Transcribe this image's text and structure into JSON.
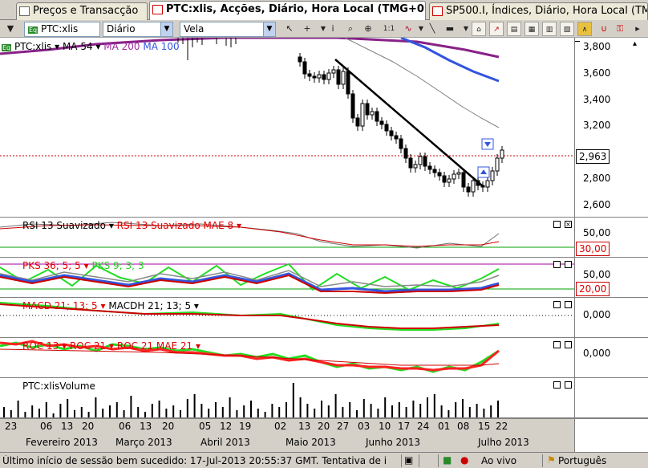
{
  "tabs": [
    {
      "label": "Preços e Transacção"
    },
    {
      "label": "PTC:xlis, Acções, Diário, Hora Local (TMG+0)"
    },
    {
      "label": "SP500.I, Índices, Diário, Hora Local (TM"
    }
  ],
  "toolbar": {
    "symbol": "PTC:xlis",
    "period": "Diário",
    "chart_style": "Vela"
  },
  "price_panel": {
    "symbol_label": "PTC:xlis",
    "indicators": [
      "MA 54",
      "MA 200",
      "MA 100"
    ],
    "last_price": "2,963",
    "y_ticks": [
      "3,800",
      "3,600",
      "3,400",
      "3,200",
      "3,000",
      "2,800",
      "2,600"
    ]
  },
  "rsi_panel": {
    "label1": "RSI 13 Suavizado",
    "label2": "RSI 13 Suavizado MAE 8",
    "ticks": [
      "50,00"
    ],
    "value": "30,00"
  },
  "pks_panel": {
    "label1": "PKS 36; 5; 5",
    "label2": "PKS 9; 3; 3",
    "ticks": [
      "50,00"
    ],
    "value": "20,00"
  },
  "macd_panel": {
    "label1": "MACD 21; 13; 5",
    "label2": "MACDH 21; 13; 5",
    "ticks": [
      "0,000"
    ]
  },
  "roc_panel": {
    "label1": "ROC 13",
    "label2": "ROC 21",
    "label3": "ROC 21 MAE 21",
    "ticks": [
      "0,000"
    ]
  },
  "volume_panel": {
    "label": "PTC:xlisVolume"
  },
  "date_axis": {
    "days": [
      "23",
      "06",
      "13",
      "20",
      "06",
      "13",
      "20",
      "05",
      "12",
      "19",
      "02",
      "13",
      "20",
      "27",
      "03",
      "10",
      "17",
      "24",
      "01",
      "08",
      "15",
      "22"
    ],
    "months": [
      "Fevereiro 2013",
      "Março 2013",
      "Abril 2013",
      "Maio 2013",
      "Junho 2013",
      "Julho 2013"
    ]
  },
  "status": {
    "message": "Último início de sessão bem sucedido: 17-Jul-2013 20:55:37 GMT. Tentativa de i",
    "connection": "Ao vivo",
    "language": "Português"
  },
  "colors": {
    "ma54": "#808080",
    "ma100": "#3355dd",
    "ma200": "#882288",
    "price_line": "#cc0000",
    "trendline": "#000000"
  }
}
